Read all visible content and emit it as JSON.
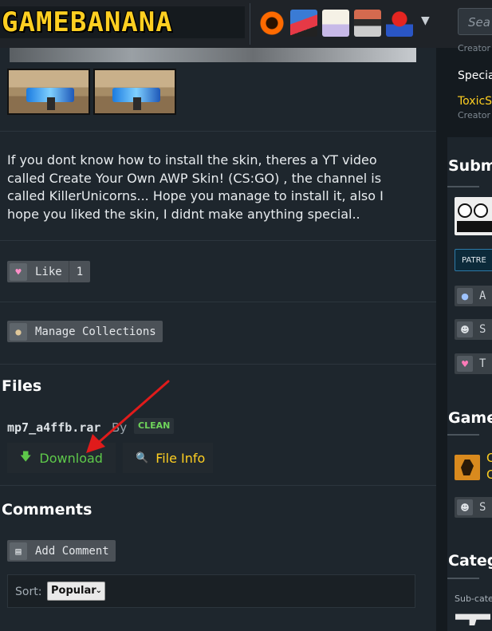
{
  "header": {
    "logo_text": "GAMEBANANA",
    "game_icons": [
      "tf2-icon",
      "fnf-icon",
      "genshin-icon",
      "pixel-game-icon",
      "mario-kart-icon"
    ],
    "search_placeholder": "Sea"
  },
  "main": {
    "description": "If you dont know how to install the skin, theres a YT video called Create Your Own AWP Skin! (CS:GO) , the channel is called KillerUnicorns... Hope you manage to install it, also I hope you liked the skin, I didnt make anything special..",
    "like_label": "Like",
    "like_count": "1",
    "manage_collections_label": "Manage Collections",
    "files": {
      "title": "Files",
      "file_name": "mp7_a4ffb.rar",
      "by_label": "By",
      "clean_badge": "CLEAN",
      "download_label": "Download",
      "file_info_label": "File Info"
    },
    "comments": {
      "title": "Comments",
      "add_comment_label": "Add Comment",
      "sort_label": "Sort:",
      "sort_value": "Popular"
    }
  },
  "sidebar": {
    "creator_label_1": "Creator",
    "special_label": "Special",
    "special_user": "ToxicS",
    "creator_label_2": "Creator",
    "submitter_heading": "Subm",
    "patreon_text": "PATRE",
    "item_a": "A",
    "item_s1": "S",
    "item_t": "T",
    "game_heading": "Game",
    "game_line1": "C",
    "game_line2": "C",
    "item_s2": "S",
    "category_heading": "Categ",
    "subcategory_label": "Sub-cate"
  },
  "colors": {
    "accent_yellow": "#ffcf21",
    "download_green": "#5ec94a",
    "annotation_red": "#e01b1b"
  }
}
